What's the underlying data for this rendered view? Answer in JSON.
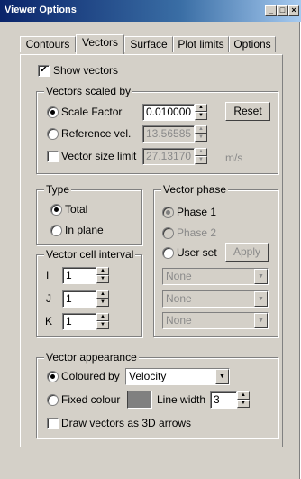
{
  "window": {
    "title": "Viewer Options"
  },
  "tabs": [
    {
      "label": "Contours"
    },
    {
      "label": "Vectors"
    },
    {
      "label": "Surface"
    },
    {
      "label": "Plot limits"
    },
    {
      "label": "Options"
    }
  ],
  "active_tab": "Vectors",
  "show_vectors": {
    "label": "Show vectors",
    "checked": true
  },
  "scaled_by": {
    "title": "Vectors scaled by",
    "scale_factor": {
      "label": "Scale Factor",
      "value": "0.010000",
      "selected": true
    },
    "reset_label": "Reset",
    "reference_vel": {
      "label": "Reference vel.",
      "value": "13.56585",
      "enabled": false
    },
    "size_limit": {
      "label": "Vector size limit",
      "value": "27.13170",
      "checked": false
    },
    "unit": "m/s"
  },
  "type": {
    "title": "Type",
    "total": {
      "label": "Total",
      "selected": true
    },
    "in_plane": {
      "label": "In plane"
    }
  },
  "cell_interval": {
    "title": "Vector cell interval",
    "i": {
      "label": "I",
      "value": "1"
    },
    "j": {
      "label": "J",
      "value": "1"
    },
    "k": {
      "label": "K",
      "value": "1"
    }
  },
  "phase": {
    "title": "Vector phase",
    "phase1": {
      "label": "Phase 1",
      "selected": true
    },
    "phase2": {
      "label": "Phase 2",
      "enabled": false
    },
    "user_set": {
      "label": "User set"
    },
    "apply_label": "Apply",
    "combos": [
      "None",
      "None",
      "None"
    ]
  },
  "appearance": {
    "title": "Vector appearance",
    "coloured_by": {
      "label": "Coloured by",
      "value": "Velocity",
      "selected": true
    },
    "fixed_colour": {
      "label": "Fixed colour",
      "swatch": "#808080"
    },
    "line_width": {
      "label": "Line width",
      "value": "3"
    },
    "draw_3d": {
      "label": "Draw vectors as 3D arrows",
      "checked": false
    }
  }
}
